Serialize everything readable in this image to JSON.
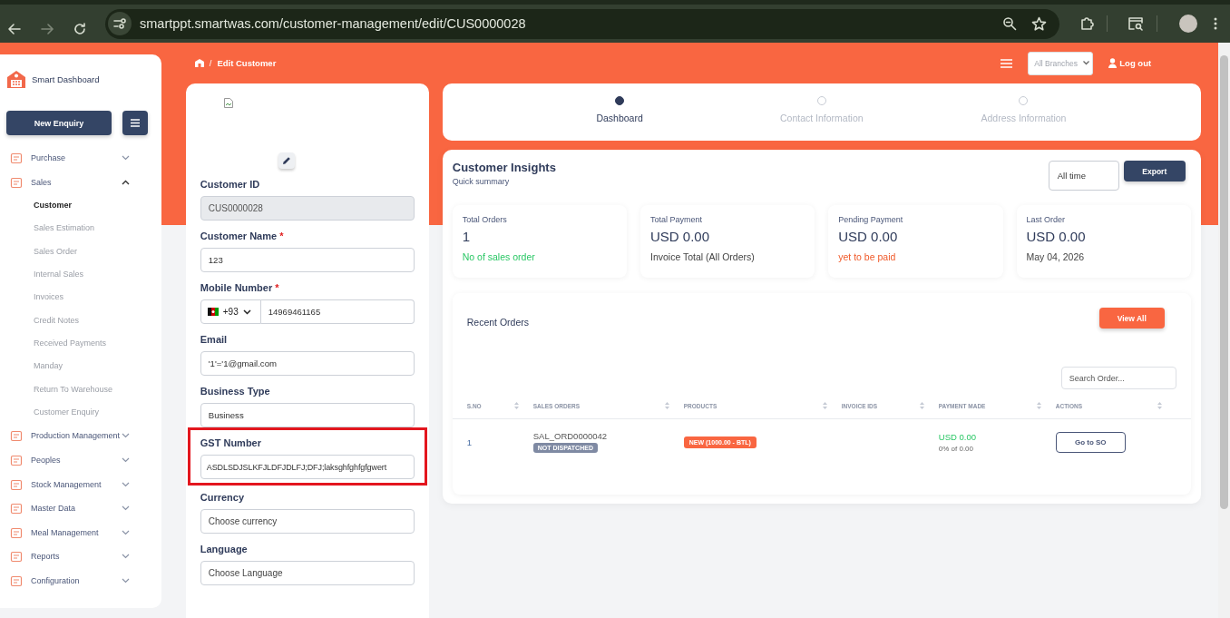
{
  "browser": {
    "url": "smartppt.smartwas.com/customer-management/edit/CUS0000028"
  },
  "breadcrumb": {
    "separator": "/",
    "title": "Edit Customer"
  },
  "header": {
    "branch_select": {
      "placeholder": "All Branches"
    },
    "logout": "Log out"
  },
  "sidebar": {
    "brand": "Smart Dashboard",
    "new_enquiry": "New Enquiry",
    "items": [
      {
        "label": "Purchase",
        "expanded": false
      },
      {
        "label": "Sales",
        "expanded": true,
        "children": [
          {
            "label": "Customer",
            "selected": true
          },
          {
            "label": "Sales Estimation",
            "selected": false
          },
          {
            "label": "Sales Order",
            "selected": false
          },
          {
            "label": "Internal Sales",
            "selected": false
          },
          {
            "label": "Invoices",
            "selected": false
          },
          {
            "label": "Credit Notes",
            "selected": false
          },
          {
            "label": "Received Payments",
            "selected": false
          },
          {
            "label": "Manday",
            "selected": false
          },
          {
            "label": "Return To Warehouse",
            "selected": false
          },
          {
            "label": "Customer Enquiry",
            "selected": false
          }
        ]
      },
      {
        "label": "Production Management",
        "expanded": false
      },
      {
        "label": "Peoples",
        "expanded": false
      },
      {
        "label": "Stock Management",
        "expanded": false
      },
      {
        "label": "Master Data",
        "expanded": false
      },
      {
        "label": "Meal Management",
        "expanded": false
      },
      {
        "label": "Reports",
        "expanded": false
      },
      {
        "label": "Configuration",
        "expanded": false
      }
    ]
  },
  "form": {
    "fields": [
      {
        "kind": "readonly",
        "label": "Customer ID",
        "value": "CUS0000028",
        "highlighted": false
      },
      {
        "kind": "text",
        "label": "Customer Name",
        "required_mark": "*",
        "value": "123",
        "highlighted": false
      },
      {
        "kind": "phone",
        "label": "Mobile Number",
        "required_mark": "*",
        "code": "+93",
        "value": "14969461165",
        "highlighted": false
      },
      {
        "kind": "text",
        "label": "Email",
        "value": "'1'='1@gmail.com",
        "highlighted": false
      },
      {
        "kind": "text",
        "label": "Business Type",
        "value": "Business",
        "highlighted": false
      },
      {
        "kind": "text",
        "label": "GST Number",
        "value": "ASDLSDJSLKFJLDFJDLFJ;DFJ;laksghfghfgfgwert",
        "highlighted": true
      },
      {
        "kind": "select",
        "label": "Currency",
        "value": "Choose currency",
        "highlighted": false
      },
      {
        "kind": "select",
        "label": "Language",
        "value": "Choose Language",
        "highlighted": false
      }
    ]
  },
  "stepper": {
    "steps": [
      {
        "label": "Dashboard",
        "selected": true
      },
      {
        "label": "Contact Information",
        "selected": false
      },
      {
        "label": "Address Information",
        "selected": false
      }
    ]
  },
  "insights": {
    "title": "Customer Insights",
    "subtitle": "Quick summary",
    "period": "All time",
    "export": "Export",
    "cards": [
      {
        "label": "Total Orders",
        "value": "1",
        "note": "No of sales order",
        "kind": "positive"
      },
      {
        "label": "Total Payment",
        "value": "USD 0.00",
        "note": "Invoice Total (All Orders)",
        "kind": "neutral"
      },
      {
        "label": "Pending Payment",
        "value": "USD 0.00",
        "note": "yet to be paid",
        "kind": "negative"
      },
      {
        "label": "Last Order",
        "value": "USD 0.00",
        "note": "May 04, 2026",
        "kind": "neutral"
      }
    ]
  },
  "recent_orders": {
    "title": "Recent Orders",
    "view_all": "View All",
    "search": {
      "placeholder": "Search Order..."
    },
    "columns": [
      "S.NO",
      "SALES ORDERS",
      "PRODUCTS",
      "INVOICE IDS",
      "PAYMENT MADE",
      "ACTIONS"
    ],
    "rows": [
      {
        "sno": "1",
        "order": "SAL_ORD0000042",
        "status": "NOT DISPATCHED",
        "product": "NEW (1000.00 - BTL)",
        "payment": "USD 0.00",
        "payment_note": "0% of 0.00",
        "action": "Go to SO"
      }
    ]
  }
}
